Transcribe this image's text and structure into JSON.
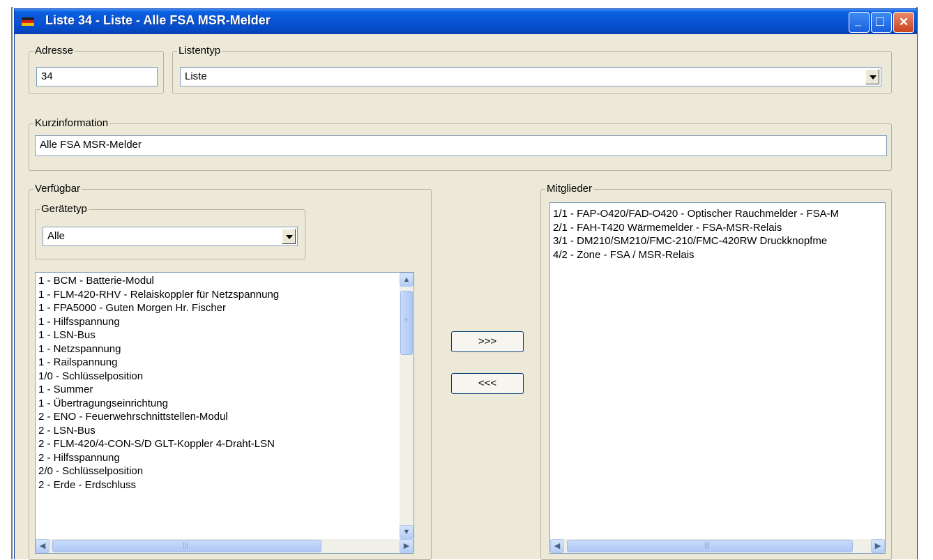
{
  "window": {
    "title": "Liste 34 - Liste - Alle FSA MSR-Melder",
    "minimize_glyph": "_",
    "maximize_glyph": "□",
    "close_glyph": "✕"
  },
  "adresse": {
    "label": "Adresse",
    "value": "34"
  },
  "listentyp": {
    "label": "Listentyp",
    "value": "Liste"
  },
  "kurzinfo": {
    "label": "Kurzinformation",
    "value": "Alle FSA MSR-Melder"
  },
  "verfuegbar": {
    "label": "Verfügbar",
    "geraetetyp_label": "Gerätetyp",
    "geraetetyp_value": "Alle",
    "items": [
      "1 - BCM - Batterie-Modul",
      "1 - FLM-420-RHV - Relaiskoppler für Netzspannung",
      "1 - FPA5000 - Guten Morgen Hr. Fischer",
      "1 - Hilfsspannung",
      "1 - LSN-Bus",
      "1 - Netzspannung",
      "1 - Railspannung",
      "1/0 - Schlüsselposition",
      "1 - Summer",
      "1 - Übertragungseinrichtung",
      "2 - ENO - Feuerwehrschnittstellen-Modul",
      "2 - LSN-Bus",
      "2 - FLM-420/4-CON-S/D GLT-Koppler 4-Draht-LSN",
      "2 - Hilfsspannung",
      "2/0 - Schlüsselposition",
      "2 - Erde - Erdschluss"
    ]
  },
  "buttons": {
    "add": ">>>",
    "remove": "<<<"
  },
  "mitglieder": {
    "label": "Mitglieder",
    "items": [
      "1/1 - FAP-O420/FAD-O420 - Optischer Rauchmelder - FSA-M",
      "2/1 - FAH-T420 Wärmemelder - FSA-MSR-Relais",
      "3/1 - DM210/SM210/FMC-210/FMC-420RW Druckknopfme",
      "4/2 - Zone - FSA / MSR-Relais"
    ]
  },
  "colors": {
    "titlebar": "#0854d6",
    "window_bg": "#ece9d8",
    "close_button": "#c8421e"
  },
  "icons": {
    "app": "app-flag-icon",
    "scroll_up": "scroll-up-icon",
    "scroll_down": "scroll-down-icon",
    "scroll_left": "scroll-left-icon",
    "scroll_right": "scroll-right-icon"
  }
}
